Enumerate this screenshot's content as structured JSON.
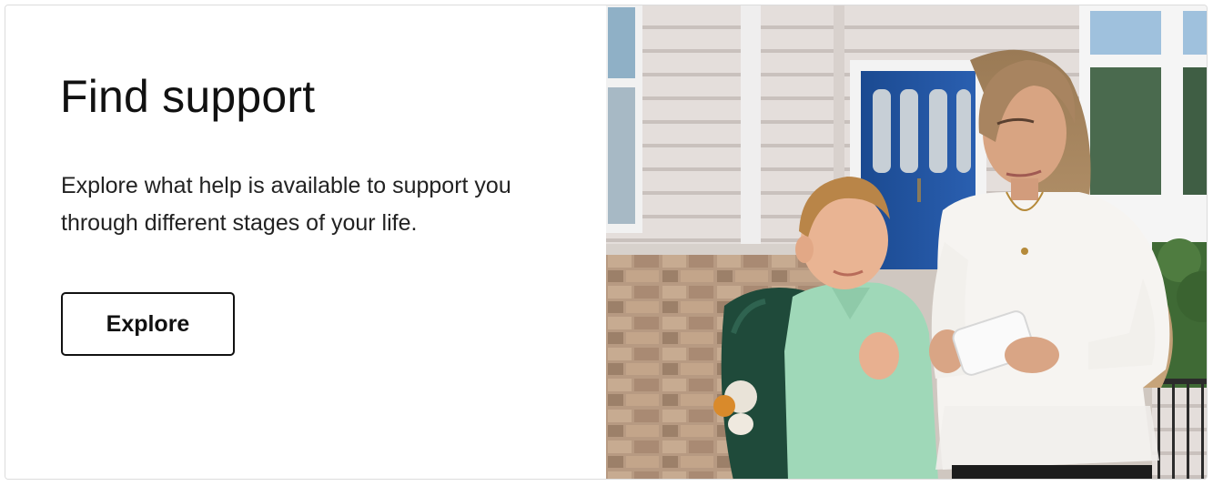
{
  "card": {
    "title": "Find support",
    "description": "Explore what help is available to support you through different stages of your life.",
    "button_label": "Explore"
  },
  "image": {
    "subject": "mother-and-son-photo"
  },
  "colors": {
    "text": "#111111",
    "border": "#dcdcdc",
    "door_blue": "#1f4f9a",
    "siding": "#e2dcd8",
    "shirt_green": "#9fd8b8",
    "backpack_green": "#1f4a3a"
  }
}
